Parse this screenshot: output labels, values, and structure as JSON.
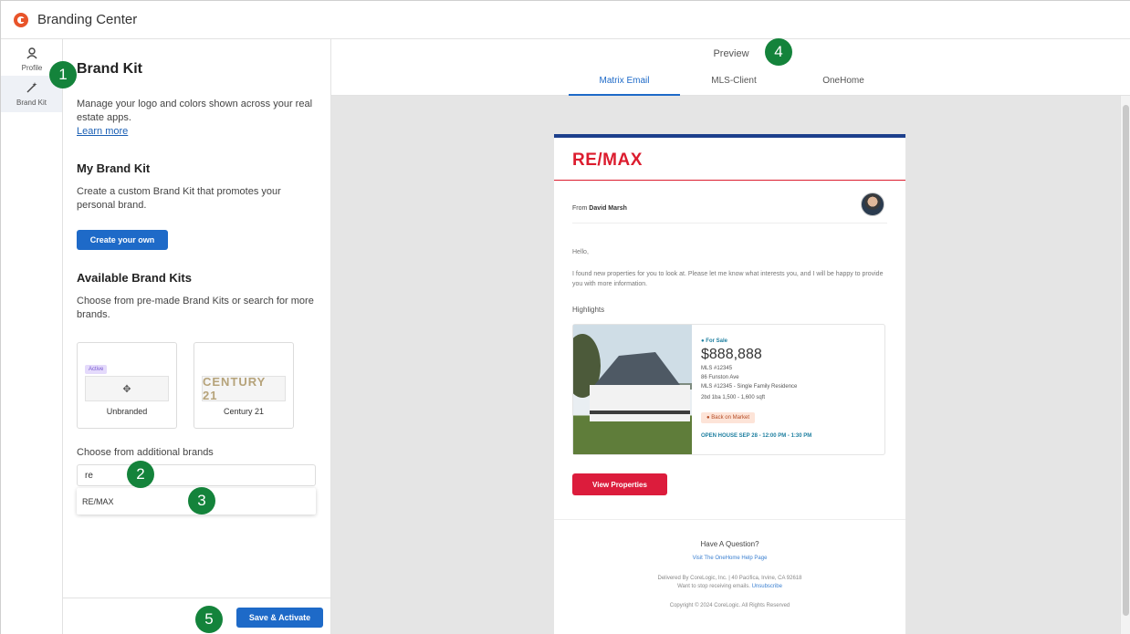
{
  "app": {
    "title": "Branding Center"
  },
  "rail": {
    "items": [
      {
        "label": "Profile",
        "icon": "user-icon"
      },
      {
        "label": "Brand Kit",
        "icon": "magic-wand-icon"
      }
    ]
  },
  "panel": {
    "title": "Brand Kit",
    "intro": "Manage your logo and colors shown across your real estate apps.",
    "learn_more": "Learn more",
    "my_kit": {
      "heading": "My Brand Kit",
      "desc": "Create a custom Brand Kit that promotes your personal brand.",
      "button": "Create your own"
    },
    "available": {
      "heading": "Available Brand Kits",
      "desc": "Choose from pre-made Brand Kits or search for more brands.",
      "kits": [
        {
          "label": "Unbranded",
          "badge": "Active"
        },
        {
          "label": "Century 21",
          "logo_text": "CENTURY 21"
        }
      ]
    },
    "additional": {
      "label": "Choose from additional brands",
      "search_value": "re",
      "suggestion": "RE/MAX"
    },
    "save_button": "Save & Activate"
  },
  "preview": {
    "title": "Preview",
    "tabs": [
      "Matrix Email",
      "MLS-Client",
      "OneHome"
    ],
    "active_tab": "Matrix Email",
    "email": {
      "brand": "RE/MAX",
      "from_prefix": "From",
      "from_name": "David Marsh",
      "greeting": "Hello,",
      "body": "I found new properties for you to look at. Please let me know what interests you, and I will be happy to provide you with more information.",
      "highlights": "Highlights",
      "listing": {
        "status": "For Sale",
        "price": "$888,888",
        "mls": "MLS #12345",
        "address": "86 Funston Ave",
        "type": "MLS #12345 - Single Family Residence",
        "specs": "2bd  1ba  1,500 - 1,600 sqft",
        "badge": "Back on Market",
        "open_house": "OPEN HOUSE SEP 28 - 12:00 PM - 1:30 PM"
      },
      "cta": "View Properties",
      "footer": {
        "question": "Have A Question?",
        "help_link": "Visit The OneHome Help Page",
        "delivered": "Delivered By CoreLogic, Inc. | 40 Pacifica, Irvine, CA 92618",
        "unsub_prefix": "Want to stop receiving emails.",
        "unsub_link": "Unsubscribe",
        "copyright": "Copyright © 2024 CoreLogic. All Rights Reserved"
      }
    }
  },
  "callouts": [
    "1",
    "2",
    "3",
    "4",
    "5"
  ],
  "colors": {
    "accent": "#1e6ac8",
    "brand_red": "#dc1c2e",
    "callout": "#14833b"
  }
}
